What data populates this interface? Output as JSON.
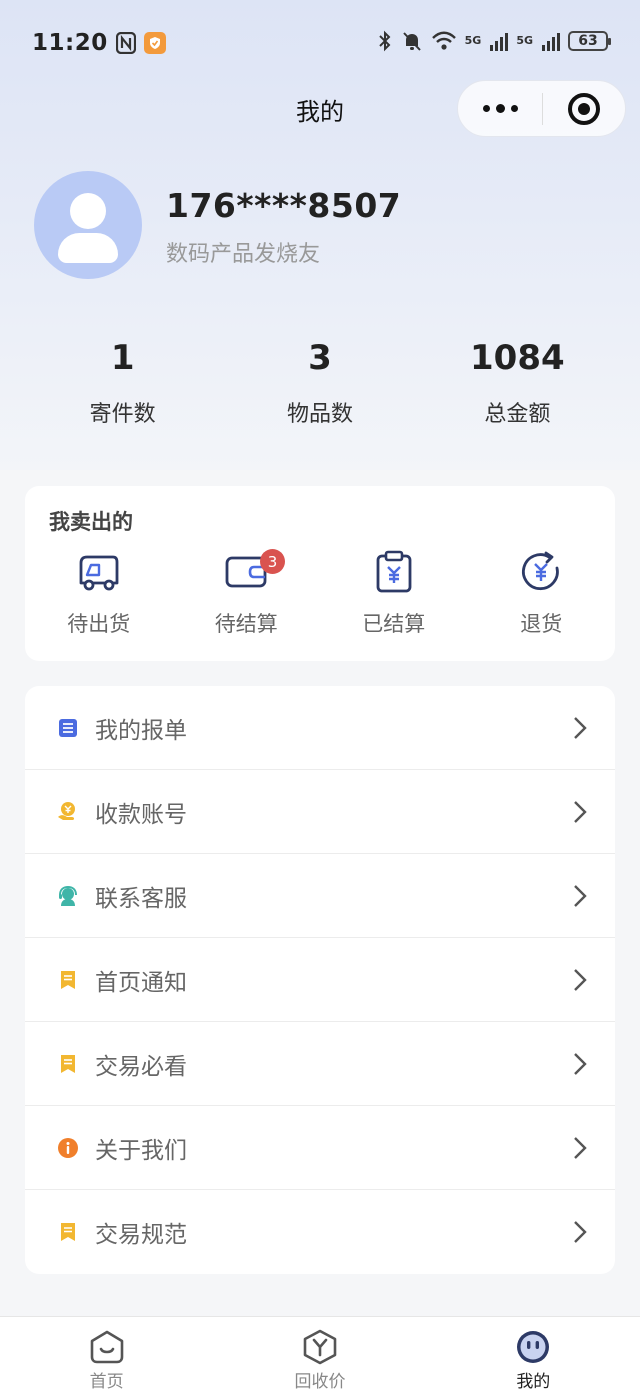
{
  "status_bar": {
    "time": "11:20",
    "network_1": "5G",
    "network_2": "5G",
    "battery": "63"
  },
  "nav": {
    "title": "我的"
  },
  "profile": {
    "phone": "176****8507",
    "nickname": "数码产品发烧友"
  },
  "stats": [
    {
      "value": "1",
      "label": "寄件数"
    },
    {
      "value": "3",
      "label": "物品数"
    },
    {
      "value": "1084",
      "label": "总金额"
    }
  ],
  "sell": {
    "title": "我卖出的",
    "items": [
      {
        "label": "待出货",
        "icon": "truck-icon"
      },
      {
        "label": "待结算",
        "icon": "wallet-icon",
        "badge": "3"
      },
      {
        "label": "已结算",
        "icon": "clipboard-yuan-icon"
      },
      {
        "label": "退货",
        "icon": "refund-icon"
      }
    ]
  },
  "menu": [
    {
      "label": "我的报单",
      "icon": "list-icon",
      "color": "#4b6be0"
    },
    {
      "label": "收款账号",
      "icon": "coin-hand-icon",
      "color": "#f2b731"
    },
    {
      "label": "联系客服",
      "icon": "service-icon",
      "color": "#3fb5a8"
    },
    {
      "label": "首页通知",
      "icon": "notice-icon",
      "color": "#f2b731"
    },
    {
      "label": "交易必看",
      "icon": "notice-icon",
      "color": "#f2b731"
    },
    {
      "label": "关于我们",
      "icon": "info-icon",
      "color": "#f07f2b"
    },
    {
      "label": "交易规范",
      "icon": "notice-icon",
      "color": "#f2b731"
    }
  ],
  "tabbar": [
    {
      "label": "首页",
      "icon": "home-icon"
    },
    {
      "label": "回收价",
      "icon": "price-icon"
    },
    {
      "label": "我的",
      "icon": "mine-icon",
      "active": true
    }
  ],
  "colors": {
    "accent": "#2d3a66",
    "badge": "#d9534f",
    "avatar_bg": "#b9caf5"
  }
}
